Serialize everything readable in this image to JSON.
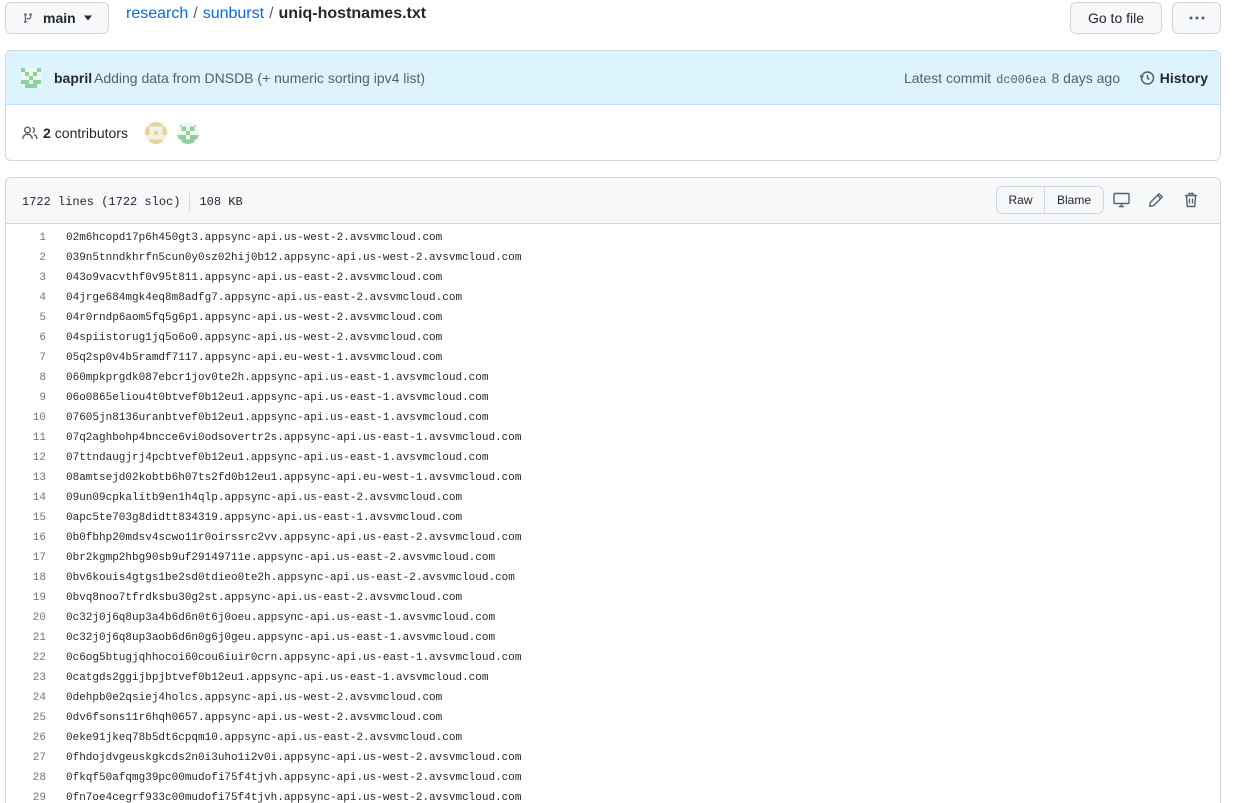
{
  "branch": {
    "name": "main"
  },
  "breadcrumb": {
    "repo": "research",
    "sep1": "/",
    "folder": "sunburst",
    "sep2": "/",
    "file": "uniq-hostnames.txt"
  },
  "actions": {
    "goto_file": "Go to file",
    "more": "···"
  },
  "commit": {
    "author": "bapril",
    "message": "Adding data from DNSDB (+ numeric sorting ipv4 list)",
    "latest_label": "Latest commit",
    "sha": "dc006ea",
    "time": "8 days ago",
    "history_label": "History"
  },
  "contributors": {
    "count": "2",
    "label": "contributors"
  },
  "file": {
    "lines_info": "1722 lines (1722 sloc)",
    "size": "108 KB",
    "raw_label": "Raw",
    "blame_label": "Blame"
  },
  "code_lines": [
    {
      "n": "1",
      "t": "02m6hcopd17p6h450gt3.appsync-api.us-west-2.avsvmcloud.com"
    },
    {
      "n": "2",
      "t": "039n5tnndkhrfn5cun0y0sz02hij0b12.appsync-api.us-west-2.avsvmcloud.com"
    },
    {
      "n": "3",
      "t": "043o9vacvthf0v95t811.appsync-api.us-east-2.avsvmcloud.com"
    },
    {
      "n": "4",
      "t": "04jrge684mgk4eq8m8adfg7.appsync-api.us-east-2.avsvmcloud.com"
    },
    {
      "n": "5",
      "t": "04r0rndp6aom5fq5g6p1.appsync-api.us-west-2.avsvmcloud.com"
    },
    {
      "n": "6",
      "t": "04spiistorug1jq5o6o0.appsync-api.us-west-2.avsvmcloud.com"
    },
    {
      "n": "7",
      "t": "05q2sp0v4b5ramdf7117.appsync-api.eu-west-1.avsvmcloud.com"
    },
    {
      "n": "8",
      "t": "060mpkprgdk087ebcr1jov0te2h.appsync-api.us-east-1.avsvmcloud.com"
    },
    {
      "n": "9",
      "t": "06o0865eliou4t0btvef0b12eu1.appsync-api.us-east-1.avsvmcloud.com"
    },
    {
      "n": "10",
      "t": "07605jn8136uranbtvef0b12eu1.appsync-api.us-east-1.avsvmcloud.com"
    },
    {
      "n": "11",
      "t": "07q2aghbohp4bncce6vi0odsovertr2s.appsync-api.us-east-1.avsvmcloud.com"
    },
    {
      "n": "12",
      "t": "07ttndaugjrj4pcbtvef0b12eu1.appsync-api.us-east-1.avsvmcloud.com"
    },
    {
      "n": "13",
      "t": "08amtsejd02kobtb6h07ts2fd0b12eu1.appsync-api.eu-west-1.avsvmcloud.com"
    },
    {
      "n": "14",
      "t": "09un09cpkalitb9en1h4qlp.appsync-api.us-east-2.avsvmcloud.com"
    },
    {
      "n": "15",
      "t": "0apc5te703g8didtt834319.appsync-api.us-east-1.avsvmcloud.com"
    },
    {
      "n": "16",
      "t": "0b0fbhp20mdsv4scwo11r0oirssrc2vv.appsync-api.us-east-2.avsvmcloud.com"
    },
    {
      "n": "17",
      "t": "0br2kgmp2hbg90sb9uf29149711e.appsync-api.us-east-2.avsvmcloud.com"
    },
    {
      "n": "18",
      "t": "0bv6kouis4gtgs1be2sd0tdieo0te2h.appsync-api.us-east-2.avsvmcloud.com"
    },
    {
      "n": "19",
      "t": "0bvq8noo7tfrdksbu30g2st.appsync-api.us-east-2.avsvmcloud.com"
    },
    {
      "n": "20",
      "t": "0c32j0j6q8up3a4b6d6n0t6j0oeu.appsync-api.us-east-1.avsvmcloud.com"
    },
    {
      "n": "21",
      "t": "0c32j0j6q8up3aob6d6n0g6j0geu.appsync-api.us-east-1.avsvmcloud.com"
    },
    {
      "n": "22",
      "t": "0c6og5btugjqhhocoi60cou6iuir0crn.appsync-api.us-east-1.avsvmcloud.com"
    },
    {
      "n": "23",
      "t": "0catgds2ggijbpjbtvef0b12eu1.appsync-api.us-east-1.avsvmcloud.com"
    },
    {
      "n": "24",
      "t": "0dehpb0e2qsiej4holcs.appsync-api.us-west-2.avsvmcloud.com"
    },
    {
      "n": "25",
      "t": "0dv6fsons11r6hqh0657.appsync-api.us-west-2.avsvmcloud.com"
    },
    {
      "n": "26",
      "t": "0eke91jkeq78b5dt6cpqm10.appsync-api.us-east-2.avsvmcloud.com"
    },
    {
      "n": "27",
      "t": "0fhdojdvgeuskgkcds2n0i3uho1i2v0i.appsync-api.us-west-2.avsvmcloud.com"
    },
    {
      "n": "28",
      "t": "0fkqf50afqmg39pc00mudofi75f4tjvh.appsync-api.us-west-2.avsvmcloud.com"
    },
    {
      "n": "29",
      "t": "0fn7oe4cegrf933c00mudofi75f4tjvh.appsync-api.us-west-2.avsvmcloud.com"
    }
  ],
  "colors": {
    "link": "#0969da",
    "commit_bg": "#ddf4ff",
    "border": "#d0d7de",
    "muted": "#57606a"
  },
  "icons": [
    "branch-icon",
    "caret-down-icon",
    "kebab-icon",
    "history-icon",
    "people-icon",
    "desktop-icon",
    "pencil-icon",
    "trash-icon"
  ]
}
